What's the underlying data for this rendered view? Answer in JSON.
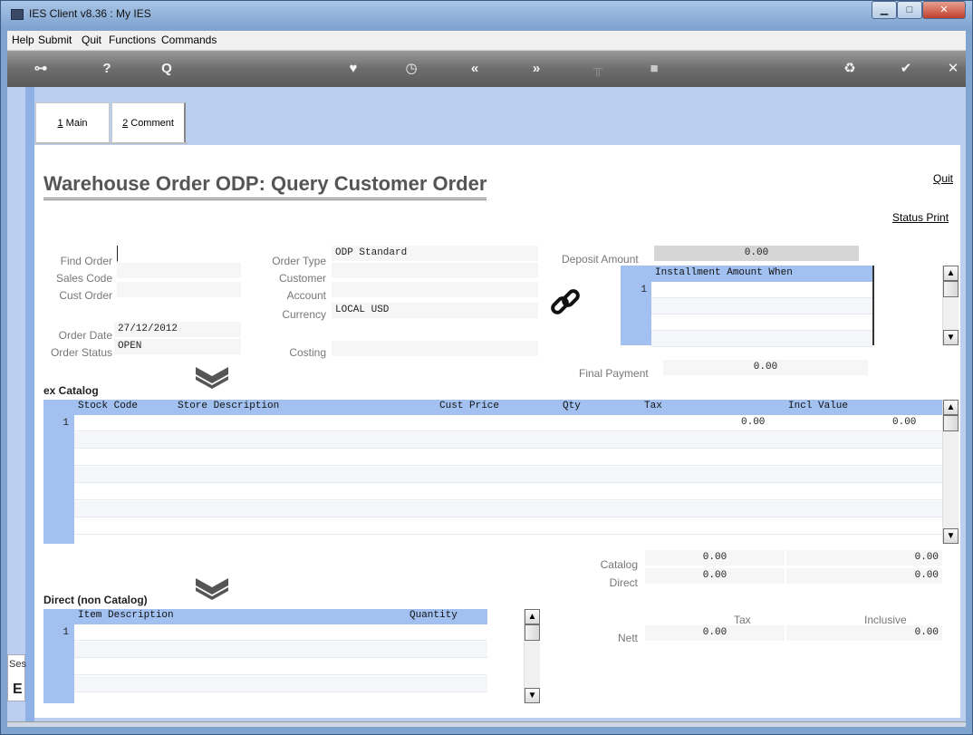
{
  "window": {
    "title": "IES Client v8.36 : My IES"
  },
  "menu": [
    "Help",
    "Submit",
    "Quit",
    "Functions",
    "Commands"
  ],
  "toolbar_icons": [
    "key-icon",
    "help-icon",
    "search-icon",
    "heart-icon",
    "clock-icon",
    "back-icon",
    "forward-icon",
    "tools-icon",
    "stop-icon",
    "recycle-icon",
    "check-icon",
    "close-icon"
  ],
  "toolbar_glyphs": {
    "key": "⊶",
    "help": "?",
    "search": "Q",
    "heart": "♥",
    "clock": "◷",
    "back": "«",
    "forward": "»",
    "tools": "╥",
    "stop": "■",
    "recycle": "♻",
    "check": "✔",
    "close": "✕"
  },
  "tabs": [
    {
      "label": "1 Main",
      "hotkey": "1",
      "rest": " Main"
    },
    {
      "label": "2 Comment",
      "hotkey": "2",
      "rest": " Comment"
    }
  ],
  "page_title": "Warehouse Order ODP: Query Customer Order",
  "links": {
    "quit": "Quit",
    "status_print": "Status Print"
  },
  "left_fields": {
    "find_order": {
      "label": "Find Order",
      "value": ""
    },
    "sales_code": {
      "label": "Sales Code",
      "value": ""
    },
    "cust_order": {
      "label": "Cust Order",
      "value": ""
    },
    "order_date": {
      "label": "Order Date",
      "value": "27/12/2012"
    },
    "order_status": {
      "label": "Order Status",
      "value": "OPEN"
    }
  },
  "mid_fields": {
    "order_type": {
      "label": "Order Type",
      "value": "ODP Standard"
    },
    "customer": {
      "label": "Customer",
      "value": ""
    },
    "account": {
      "label": "Account",
      "value": ""
    },
    "currency": {
      "label": "Currency",
      "value": "LOCAL USD"
    },
    "costing": {
      "label": "Costing",
      "value": ""
    }
  },
  "deposit": {
    "label": "Deposit Amount",
    "value": "0.00"
  },
  "installment": {
    "header": "Installment Amount When",
    "rows": [
      "1",
      "",
      "",
      ""
    ]
  },
  "final_payment": {
    "label": "Final Payment",
    "value": "0.00"
  },
  "ex_catalog": {
    "title": "ex Catalog",
    "columns": [
      "Stock Code",
      "Store Description",
      "Cust Price",
      "Qty",
      "Tax",
      "Incl Value"
    ],
    "rows": [
      {
        "num": "1",
        "stock_code": "",
        "store_description": "",
        "cust_price": "",
        "qty": "",
        "tax": "0.00",
        "incl_value": "0.00"
      }
    ]
  },
  "totals": {
    "catalog": {
      "label": "Catalog",
      "tax": "0.00",
      "incl": "0.00"
    },
    "direct": {
      "label": "Direct",
      "tax": "0.00",
      "incl": "0.00"
    },
    "col_tax": "Tax",
    "col_inclusive": "Inclusive",
    "nett": {
      "label": "Nett",
      "tax": "0.00",
      "incl": "0.00"
    }
  },
  "direct": {
    "title": "Direct (non Catalog)",
    "columns": [
      "Item Description",
      "Quantity"
    ],
    "rows": [
      {
        "num": "1",
        "description": "",
        "quantity": ""
      }
    ]
  },
  "side": {
    "ses": "Ses",
    "glyph": "E"
  },
  "scroll_glyphs": {
    "up": "▲",
    "down": "▼"
  }
}
